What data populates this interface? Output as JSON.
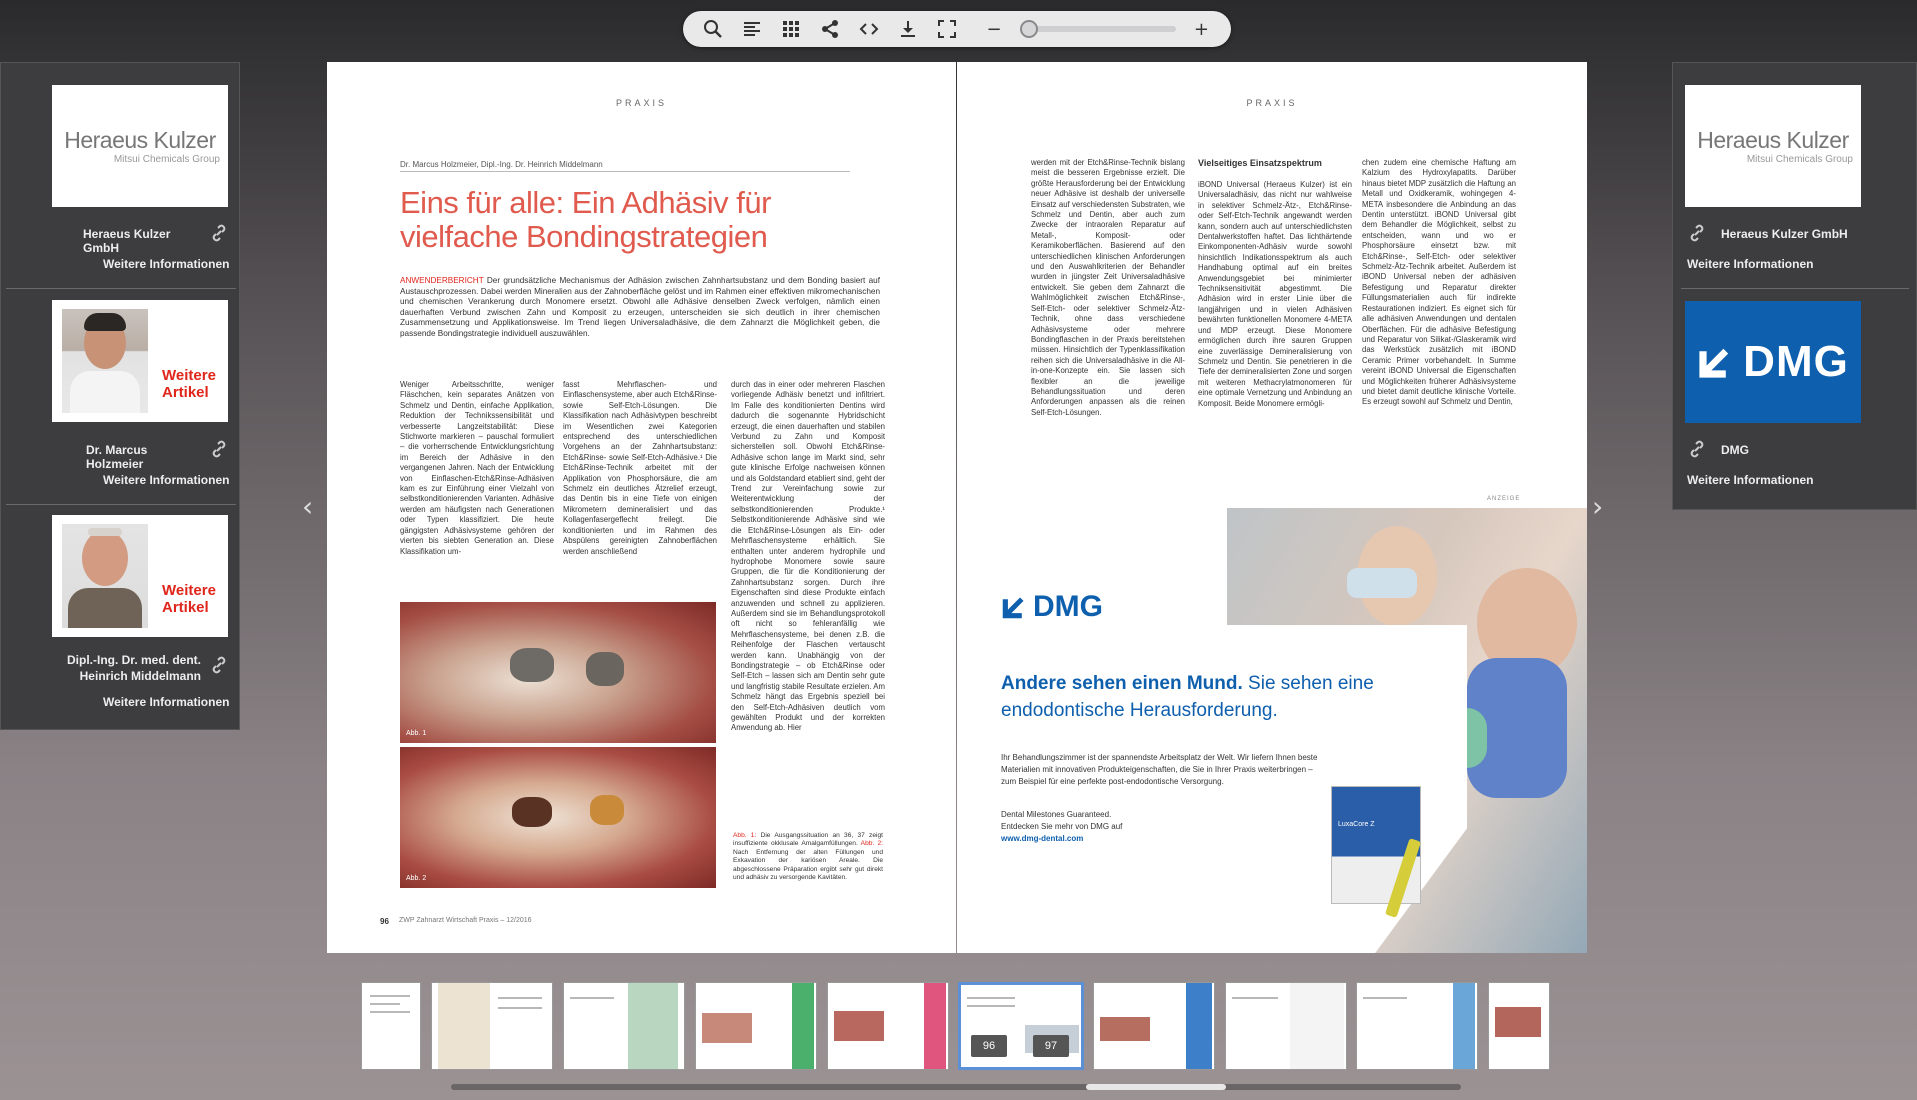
{
  "toolbar": {
    "icons": [
      "search-icon",
      "contents-icon",
      "grid-icon",
      "share-icon",
      "embed-icon",
      "download-icon",
      "fullscreen-icon"
    ],
    "zoom_out": "−",
    "zoom_in": "+",
    "zoom_level": 0
  },
  "left_panel": {
    "sponsor_logo": {
      "name": "Heraeus Kulzer",
      "sub": "Mitsui Chemicals Group"
    },
    "sponsor_name": "Heraeus Kulzer GmbH",
    "sponsor_more": "Weitere Informationen",
    "author1": {
      "badge": "Weitere Artikel",
      "name": "Dr. Marcus Holzmeier",
      "more": "Weitere Informationen"
    },
    "author2": {
      "badge": "Weitere Artikel",
      "name": "Dipl.-Ing. Dr. med. dent. Heinrich Middelmann",
      "more": "Weitere Informationen"
    }
  },
  "right_panel": {
    "sponsor_logo": {
      "name": "Heraeus Kulzer",
      "sub": "Mitsui Chemicals Group"
    },
    "sponsor_name": "Heraeus Kulzer GmbH",
    "sponsor_more": "Weitere Informationen",
    "dmg_logo": "DMG",
    "dmg_name": "DMG",
    "dmg_more": "Weitere Informationen"
  },
  "left_page": {
    "section": "PRAXIS",
    "authors": "Dr. Marcus Holzmeier, Dipl.-Ing. Dr. Heinrich Middelmann",
    "title": "Eins für alle: Ein Adhäsiv für vielfache Bondingstrategien",
    "lead_tag": "ANWENDERBERICHT",
    "lead": "Der grundsätzliche Mechanismus der Adhäsion zwischen Zahnhartsubstanz und dem Bonding basiert auf Austauschprozessen. Dabei werden Mineralien aus der Zahnoberfläche gelöst und im Rahmen einer effektiven mikromechanischen und chemischen Verankerung durch Monomere ersetzt. Obwohl alle Adhäsive denselben Zweck verfolgen, nämlich einen dauerhaften Verbund zwischen Zahn und Komposit zu erzeugen, unterscheiden sie sich deutlich in ihrer chemischen Zusammensetzung und Applikationsweise. Im Trend liegen Universaladhäsive, die dem Zahnarzt die Möglichkeit geben, die passende Bondingstrategie individuell auszuwählen.",
    "col1": "Weniger Arbeitsschritte, weniger Fläschchen, kein separates Anätzen von Schmelz und Dentin, einfache Applikation, Reduktion der Technikssensibilität und verbesserte Langzeitstabilität: Diese Stichworte markieren – pauschal formuliert – die vorherrschende Entwicklungsrichtung im Bereich der Adhäsive in den vergangenen Jahren. Nach der Entwicklung von Einflaschen-Etch&Rinse-Adhäsiven kam es zur Einführung einer Vielzahl von selbstkonditionierenden Varianten. Adhäsive werden am häufigsten nach Generationen oder Typen klassifiziert. Die heute gängigsten Adhäsivsysteme gehören der vierten bis siebten Generation an. Diese Klassifikation um-",
    "col2": "fasst Mehrflaschen- und Einflaschensysteme, aber auch Etch&Rinse- sowie Self-Etch-Lösungen. Die Klassifikation nach Adhäsivtypen beschreibt im Wesentlichen zwei Kategorien entsprechend des unterschiedlichen Vorgehens an der Zahnhartsubstanz: Etch&Rinse- sowie Self-Etch-Adhäsive.¹ Die Etch&Rinse-Technik arbeitet mit der Applikation von Phosphorsäure, die am Schmelz ein deutliches Ätzrelief erzeugt, das Dentin bis in eine Tiefe von einigen Mikrometern demineralisiert und das Kollagenfasergeflecht freilegt. Die konditionierten und im Rahmen des Abspülens gereinigten Zahnoberflächen werden anschließend",
    "col3": "durch das in einer oder mehreren Flaschen vorliegende Adhäsiv benetzt und infiltriert. Im Falle des konditionierten Dentins wird dadurch die sogenannte Hybridschicht erzeugt, die einen dauerhaften und stabilen Verbund zu Zahn und Komposit sicherstellen soll. Obwohl Etch&Rinse-Adhäsive schon lange im Markt sind, sehr gute klinische Erfolge nachweisen können und als Goldstandard etabliert sind, geht der Trend zur Vereinfachung sowie zur Weiterentwicklung der selbstkonditionierenden Produkte.¹ Selbstkonditionierende Adhäsive sind wie die Etch&Rinse-Lösungen als Ein- oder Mehrflaschensysteme erhältlich. Sie enthalten unter anderem hydrophile und hydrophobe Monomere sowie saure Gruppen, die für die Konditionierung der Zahnhartsubstanz sorgen. Durch ihre Eigenschaften sind diese Produkte einfach anzuwenden und schnell zu applizieren. Außerdem sind sie im Behandlungsprotokoll oft nicht so fehleranfällig wie Mehrflaschensysteme, bei denen z.B. die Reihenfolge der Flaschen vertauscht werden kann. Unabhängig von der Bondingstrategie – ob Etch&Rinse oder Self-Etch – lassen sich am Dentin sehr gute und langfristig stabile Resultate erzielen. Am Schmelz hängt das Ergebnis speziell bei den Self-Etch-Adhäsiven deutlich vom gewählten Produkt und der korrekten Anwendung ab. Hier",
    "fig1": "Abb. 1",
    "fig2": "Abb. 2",
    "caption_a": "Abb. 1:",
    "caption_a_text": "Die Ausgangssituation an 36, 37 zeigt insuffiziente okklusale Amalgamfüllungen.",
    "caption_b": "Abb. 2:",
    "caption_b_text": "Nach Entfernung der alten Füllungen und Exkavation der kariösen Areale. Die abgeschlossene Präparation ergibt sehr gut direkt und adhäsiv zu versorgende Kavitäten.",
    "page_num": "96",
    "footer": "ZWP Zahnarzt Wirtschaft Praxis – 12/2016"
  },
  "right_page": {
    "section": "PRAXIS",
    "col1": "werden mit der Etch&Rinse-Technik bislang meist die besseren Ergebnisse erzielt. Die größte Herausforderung bei der Entwicklung neuer Adhäsive ist deshalb der universelle Einsatz auf verschiedensten Substraten, wie Schmelz und Dentin, aber auch zum Zwecke der intraoralen Reparatur auf Metall-, Komposit- oder Keramikoberflächen. Basierend auf den unterschiedlichen klinischen Anforderungen und den Auswahlkriterien der Behandler wurden in jüngster Zeit Universaladhäsive entwickelt. Sie geben dem Zahnarzt die Wahlmöglichkeit zwischen Etch&Rinse-, Self-Etch- oder selektiver Schmelz-Ätz-Technik, ohne dass verschiedene Adhäsivsysteme oder mehrere Bondingflaschen in der Praxis bereitstehen müssen. Hinsichtlich der Typenklassifikation reihen sich die Universaladhäsive in die All-in-one-Konzepte ein. Sie lassen sich flexibler an die jeweilige Behandlungssituation und deren Anforderungen anpassen als die reinen Self-Etch-Lösungen.",
    "col2_head": "Vielseitiges Einsatzspektrum",
    "col2": "iBOND Universal (Heraeus Kulzer) ist ein Universaladhäsiv, das nicht nur wahlweise in selektiver Schmelz-Ätz-, Etch&Rinse- oder Self-Etch-Technik angewandt werden kann, sondern auch auf unterschiedlichsten Dentalwerkstoffen haftet. Das lichthärtende Einkomponenten-Adhäsiv wurde sowohl hinsichtlich Indikationsspektrum als auch Handhabung optimal auf ein breites Anwendungsgebiet bei minimierter Techniksensitivität abgestimmt. Die Adhäsion wird in erster Linie über die langjährigen und in vielen Adhäsiven bewährten funktionellen Monomere 4-META und MDP erzeugt. Diese Monomere ermöglichen durch ihre sauren Gruppen eine zuverlässige Demineralisierung von Schmelz und Dentin. Sie penetrieren in die Tiefe der demineralisierten Zone und sorgen mit weiteren Methacrylatmonomeren für eine optimale Vernetzung und Anbindung an Komposit. Beide Monomere ermögli-",
    "col3": "chen zudem eine chemische Haftung am Kalzium des Hydroxylapatits. Darüber hinaus bietet MDP zusätzlich die Haftung an Metall und Oxidkeramik, wohingegen 4-META insbesondere die Anbindung an das Dentin unterstützt. iBOND Universal gibt dem Behandler die Möglichkeit, selbst zu entscheiden, wann und wo er Phosphorsäure einsetzt bzw. mit Etch&Rinse-, Self-Etch- oder selektiver Schmelz-Ätz-Technik arbeitet. Außerdem ist iBOND Universal neben der adhäsiven Befestigung und Reparatur direkter Füllungsmaterialien auch für indirekte Restaurationen indiziert. Es eignet sich für alle adhäsiven Anwendungen und dentalen Oberflächen. Für die adhäsive Befestigung und Reparatur von Silikat-/Glaskeramik wird das Werkstück zusätzlich mit iBOND Ceramic Primer vorbehandelt. In Summe vereint iBOND Universal die Eigenschaften und Möglichkeiten früherer Adhäsivsysteme und bietet damit deutliche klinische Vorteile. Es erzeugt sowohl auf Schmelz und Dentin,",
    "anzeige": "ANZEIGE",
    "ad": {
      "logo": "DMG",
      "headline_a": "Andere sehen einen Mund.",
      "headline_b": "Sie sehen eine endodontische Herausforderung.",
      "body": "Ihr Behandlungszimmer ist der spannendste Arbeitsplatz der Welt. Wir liefern Ihnen beste Materialien mit innovativen Produkteigenschaften, die Sie in Ihrer Praxis weiterbringen – zum Beispiel für eine perfekte post-endodontische Versorgung.",
      "tag1": "Dental Milestones Guaranteed.",
      "tag2": "Entdecken Sie mehr von DMG auf",
      "url": "www.dmg-dental.com",
      "product": "LuxaCore Z"
    }
  },
  "thumbnails": {
    "active_left": "96",
    "active_right": "97"
  },
  "colors": {
    "accent_red": "#e0251b",
    "dmg_blue": "#0e5fae",
    "title_red": "#e05a4e"
  }
}
